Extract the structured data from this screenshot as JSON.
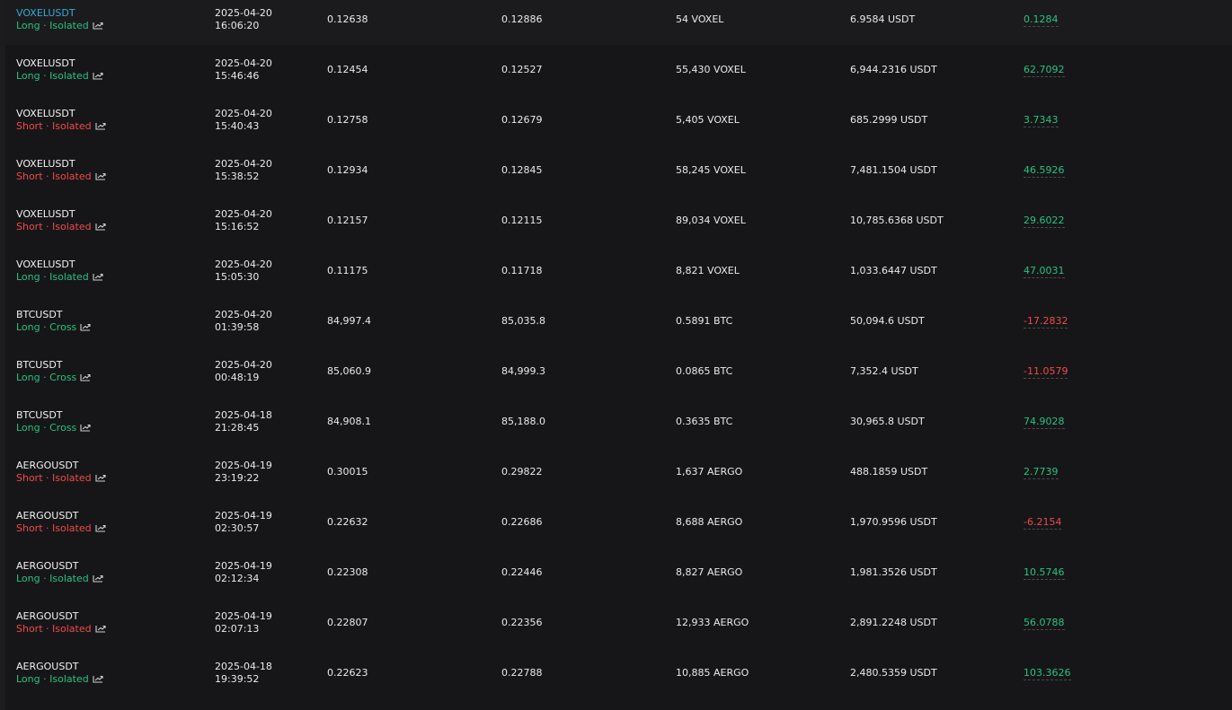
{
  "colors": {
    "background": "#161618",
    "long": "#26c281",
    "short": "#f0494a",
    "active_symbol": "#36a9d6",
    "text": "#eaeaea"
  },
  "positions": [
    {
      "symbol": "VOXELUSDT",
      "side": "Long",
      "margin": "Isolated",
      "date": "2025-04-20",
      "time": "16:06:20",
      "entry": "0.12638",
      "exit": "0.12886",
      "qty": "54 VOXEL",
      "value": "6.9584 USDT",
      "pnl": "0.1284",
      "pnl_sign": "pos",
      "active": true
    },
    {
      "symbol": "VOXELUSDT",
      "side": "Long",
      "margin": "Isolated",
      "date": "2025-04-20",
      "time": "15:46:46",
      "entry": "0.12454",
      "exit": "0.12527",
      "qty": "55,430 VOXEL",
      "value": "6,944.2316 USDT",
      "pnl": "62.7092",
      "pnl_sign": "pos"
    },
    {
      "symbol": "VOXELUSDT",
      "side": "Short",
      "margin": "Isolated",
      "date": "2025-04-20",
      "time": "15:40:43",
      "entry": "0.12758",
      "exit": "0.12679",
      "qty": "5,405 VOXEL",
      "value": "685.2999 USDT",
      "pnl": "3.7343",
      "pnl_sign": "pos"
    },
    {
      "symbol": "VOXELUSDT",
      "side": "Short",
      "margin": "Isolated",
      "date": "2025-04-20",
      "time": "15:38:52",
      "entry": "0.12934",
      "exit": "0.12845",
      "qty": "58,245 VOXEL",
      "value": "7,481.1504 USDT",
      "pnl": "46.5926",
      "pnl_sign": "pos"
    },
    {
      "symbol": "VOXELUSDT",
      "side": "Short",
      "margin": "Isolated",
      "date": "2025-04-20",
      "time": "15:16:52",
      "entry": "0.12157",
      "exit": "0.12115",
      "qty": "89,034 VOXEL",
      "value": "10,785.6368 USDT",
      "pnl": "29.6022",
      "pnl_sign": "pos"
    },
    {
      "symbol": "VOXELUSDT",
      "side": "Long",
      "margin": "Isolated",
      "date": "2025-04-20",
      "time": "15:05:30",
      "entry": "0.11175",
      "exit": "0.11718",
      "qty": "8,821 VOXEL",
      "value": "1,033.6447 USDT",
      "pnl": "47.0031",
      "pnl_sign": "pos"
    },
    {
      "symbol": "BTCUSDT",
      "side": "Long",
      "margin": "Cross",
      "date": "2025-04-20",
      "time": "01:39:58",
      "entry": "84,997.4",
      "exit": "85,035.8",
      "qty": "0.5891 BTC",
      "value": "50,094.6 USDT",
      "pnl": "-17.2832",
      "pnl_sign": "neg"
    },
    {
      "symbol": "BTCUSDT",
      "side": "Long",
      "margin": "Cross",
      "date": "2025-04-20",
      "time": "00:48:19",
      "entry": "85,060.9",
      "exit": "84,999.3",
      "qty": "0.0865 BTC",
      "value": "7,352.4 USDT",
      "pnl": "-11.0579",
      "pnl_sign": "neg"
    },
    {
      "symbol": "BTCUSDT",
      "side": "Long",
      "margin": "Cross",
      "date": "2025-04-18",
      "time": "21:28:45",
      "entry": "84,908.1",
      "exit": "85,188.0",
      "qty": "0.3635 BTC",
      "value": "30,965.8 USDT",
      "pnl": "74.9028",
      "pnl_sign": "pos"
    },
    {
      "symbol": "AERGOUSDT",
      "side": "Short",
      "margin": "Isolated",
      "date": "2025-04-19",
      "time": "23:19:22",
      "entry": "0.30015",
      "exit": "0.29822",
      "qty": "1,637 AERGO",
      "value": "488.1859 USDT",
      "pnl": "2.7739",
      "pnl_sign": "pos"
    },
    {
      "symbol": "AERGOUSDT",
      "side": "Short",
      "margin": "Isolated",
      "date": "2025-04-19",
      "time": "02:30:57",
      "entry": "0.22632",
      "exit": "0.22686",
      "qty": "8,688 AERGO",
      "value": "1,970.9596 USDT",
      "pnl": "-6.2154",
      "pnl_sign": "neg"
    },
    {
      "symbol": "AERGOUSDT",
      "side": "Long",
      "margin": "Isolated",
      "date": "2025-04-19",
      "time": "02:12:34",
      "entry": "0.22308",
      "exit": "0.22446",
      "qty": "8,827 AERGO",
      "value": "1,981.3526 USDT",
      "pnl": "10.5746",
      "pnl_sign": "pos"
    },
    {
      "symbol": "AERGOUSDT",
      "side": "Short",
      "margin": "Isolated",
      "date": "2025-04-19",
      "time": "02:07:13",
      "entry": "0.22807",
      "exit": "0.22356",
      "qty": "12,933 AERGO",
      "value": "2,891.2248 USDT",
      "pnl": "56.0788",
      "pnl_sign": "pos"
    },
    {
      "symbol": "AERGOUSDT",
      "side": "Long",
      "margin": "Isolated",
      "date": "2025-04-18",
      "time": "19:39:52",
      "entry": "0.22623",
      "exit": "0.22788",
      "qty": "10,885 AERGO",
      "value": "2,480.5359 USDT",
      "pnl": "103.3626",
      "pnl_sign": "pos"
    }
  ],
  "separator": " · ",
  "icons": {
    "share": "share-chart-icon"
  }
}
